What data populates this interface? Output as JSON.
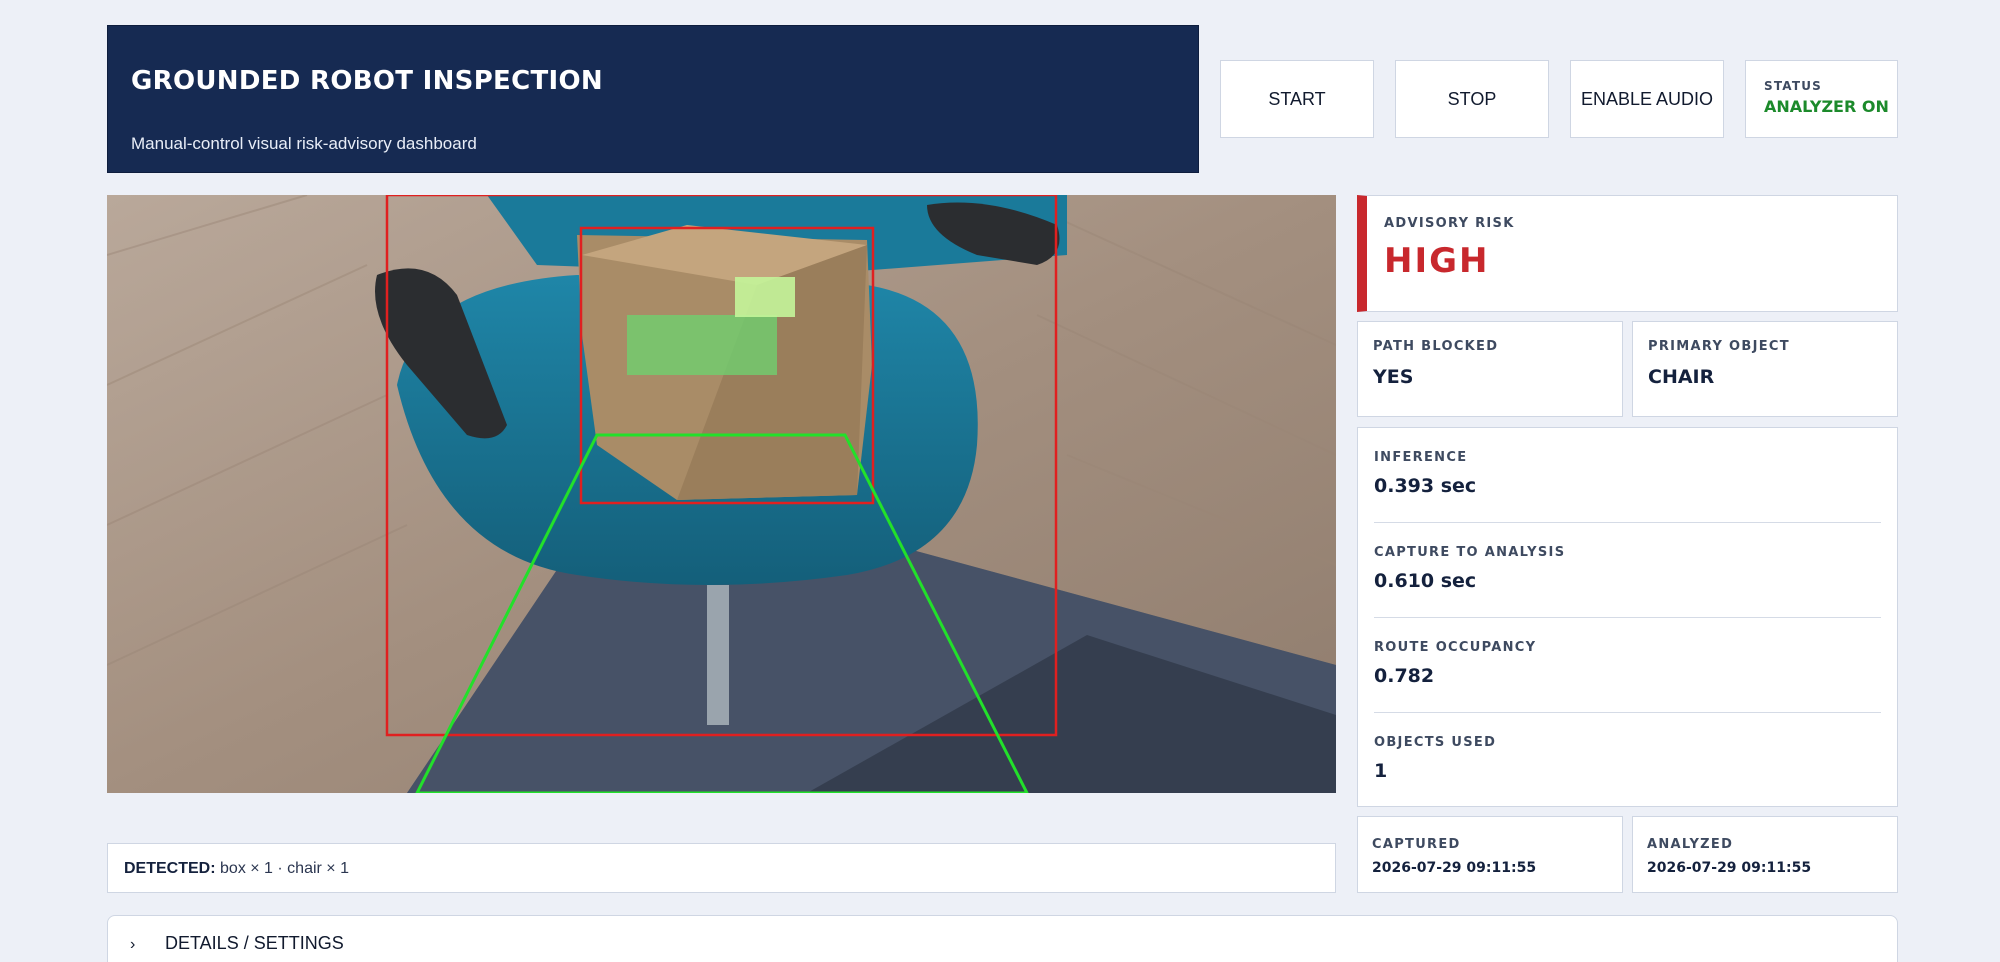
{
  "header": {
    "title": "GROUNDED ROBOT INSPECTION",
    "subtitle": "Manual-control visual risk-advisory dashboard"
  },
  "controls": {
    "start_label": "START",
    "stop_label": "STOP",
    "audio_label": "ENABLE AUDIO"
  },
  "status": {
    "label": "STATUS",
    "value": "ANALYZER ON",
    "color": "#1c8a2b"
  },
  "camera": {
    "detections": [
      {
        "label": "chair",
        "color": "#e02020"
      },
      {
        "label": "box",
        "color": "#e02020"
      }
    ],
    "route_color": "#22e02a"
  },
  "detected": {
    "label": "DETECTED:",
    "value": "box × 1 · chair × 1"
  },
  "risk": {
    "label": "ADVISORY RISK",
    "value": "HIGH",
    "color": "#c8282d"
  },
  "path_blocked": {
    "label": "PATH BLOCKED",
    "value": "YES"
  },
  "primary_object": {
    "label": "PRIMARY OBJECT",
    "value": "CHAIR"
  },
  "metrics": [
    {
      "label": "INFERENCE",
      "value": "0.393 sec"
    },
    {
      "label": "CAPTURE TO ANALYSIS",
      "value": "0.610 sec"
    },
    {
      "label": "ROUTE OCCUPANCY",
      "value": "0.782"
    },
    {
      "label": "OBJECTS USED",
      "value": "1"
    }
  ],
  "captured": {
    "label": "CAPTURED",
    "value": "2026-07-29 09:11:55"
  },
  "analyzed": {
    "label": "ANALYZED",
    "value": "2026-07-29 09:11:55"
  },
  "details": {
    "chevron_icon": "chevron-right-icon",
    "label": "DETAILS / SETTINGS"
  }
}
